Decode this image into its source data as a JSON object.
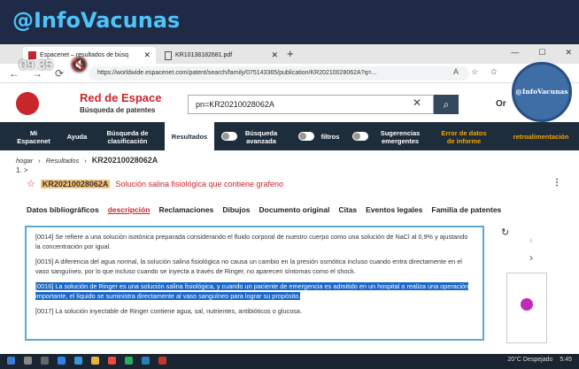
{
  "banner": {
    "title": "@InfoVacunas"
  },
  "video": {
    "time": "09:35"
  },
  "watermark": {
    "text": "@InfoVacunas"
  },
  "browser": {
    "tabs": [
      {
        "label": "Espacenet – resultados de búsq"
      },
      {
        "label": "KR10138182681.pdf"
      }
    ],
    "url": "https://worldwide.espacenet.com/patent/search/family/075143365/publication/KR20210028062A?q=..."
  },
  "espacenet": {
    "brand_title": "Red de Espace",
    "brand_subtitle": "Búsqueda de patentes",
    "search_value": "pn=KR20210028062A",
    "partial_right": "Or",
    "nav": {
      "my_espacenet": "Mi Espacenet",
      "help": "Ayuda",
      "classification": "Búsqueda de clasificación",
      "results": "Resultados",
      "advanced": "Búsqueda avanzada",
      "filters": "filtros",
      "suggestions": "Sugerencias emergentes",
      "data_error": "Error de datos de informe",
      "feedback": "retroalimentación"
    }
  },
  "content": {
    "crumbs": {
      "home": "hogar",
      "results": "Resultados",
      "current": "KR20210028062A"
    },
    "count": "1. >",
    "patent_number": "KR20210028062A",
    "patent_title": "Solución salina fisiológica que contiene grafeno",
    "tabs": [
      "Datos bibliográficos",
      "descripción",
      "Reclamaciones",
      "Dibujos",
      "Documento original",
      "Citas",
      "Eventos legales",
      "Familia de patentes"
    ],
    "paragraphs": {
      "p14": "[0014] Se refiere a una solución isotónica preparada considerando el fluido corporal de nuestro cuerpo como una solución de NaCl al 0,9% y ajustando la concentración por igual.",
      "p15": "[0015] A diferencia del agua normal, la solución salina fisiológica no causa un cambio en la presión osmótica incluso cuando entra directamente en el vaso sanguíneo, por lo que incluso cuando se inyecta a través de Ringer, no aparecen síntomas como el shock.",
      "p16_a": "[0016] La solución de Ringer es una solución salina fisiológica,",
      "p16_b": " y cuando un paciente de emergencia es admitido en un hospital o realiza una operación importante, el líquido se suministra directamente al vaso sanguíneo para lograr su propósito.",
      "p17": "[0017] La solución inyectable de Ringer contiene agua, sal, nutrientes, antibióticos o glucosa."
    }
  },
  "taskbar": {
    "weather": "20°C  Despejado",
    "time": "5:45"
  }
}
